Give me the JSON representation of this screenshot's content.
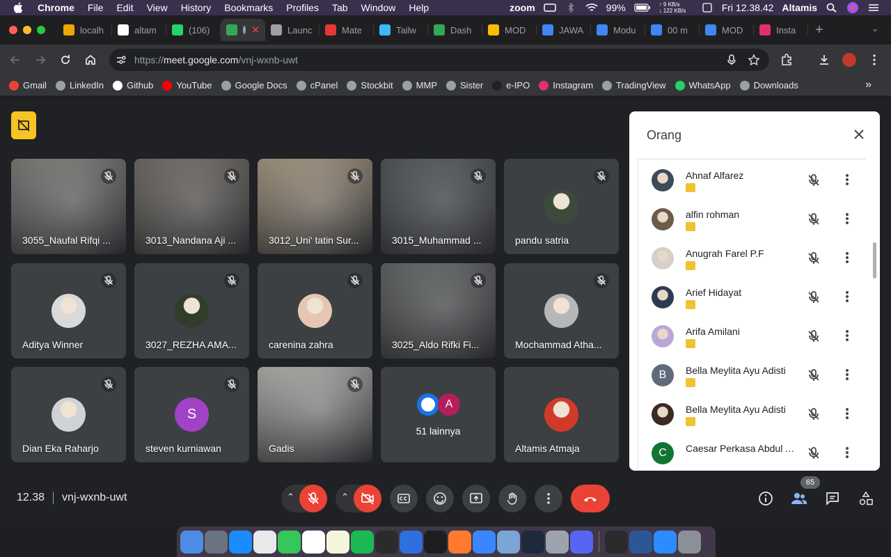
{
  "menubar": {
    "app_name": "Chrome",
    "menus": [
      "File",
      "Edit",
      "View",
      "History",
      "Bookmarks",
      "Profiles",
      "Tab",
      "Window",
      "Help"
    ],
    "zoom_label": "zoom",
    "net_up": "↑ 9 KB/s",
    "net_down": "↓ 122 KB/s",
    "battery": "99%",
    "clock": "Fri 12.38.42",
    "user": "Altamis"
  },
  "tabs": [
    {
      "label": "localh",
      "color": "#f0a500"
    },
    {
      "label": "altam",
      "color": "#ffffff"
    },
    {
      "label": "(106)",
      "color": "#25d366"
    },
    {
      "label": "",
      "color": "#34a853",
      "active": true
    },
    {
      "label": "Launc",
      "color": "#9aa0a6"
    },
    {
      "label": "Mate",
      "color": "#e53935"
    },
    {
      "label": "Tailw",
      "color": "#38bdf8"
    },
    {
      "label": "Dash",
      "color": "#34a853"
    },
    {
      "label": "MOD",
      "color": "#fbbc04"
    },
    {
      "label": "JAWA",
      "color": "#4285f4"
    },
    {
      "label": "Modu",
      "color": "#4285f4"
    },
    {
      "label": "00 m",
      "color": "#4285f4"
    },
    {
      "label": "MOD",
      "color": "#4285f4"
    },
    {
      "label": "Insta",
      "color": "#e1306c"
    }
  ],
  "omnibox": {
    "url_prefix": "https://",
    "url_host": "meet.google.com",
    "url_path": "/vnj-wxnb-uwt"
  },
  "bookmarks": [
    {
      "label": "Gmail",
      "color": "#ea4335"
    },
    {
      "label": "LinkedIn",
      "color": "#9aa0a6"
    },
    {
      "label": "Github",
      "color": "#ffffff"
    },
    {
      "label": "YouTube",
      "color": "#ff0000"
    },
    {
      "label": "Google Docs",
      "color": "#9aa0a6"
    },
    {
      "label": "cPanel",
      "color": "#9aa0a6"
    },
    {
      "label": "Stockbit",
      "color": "#9aa0a6"
    },
    {
      "label": "MMP",
      "color": "#9aa0a6"
    },
    {
      "label": "Sister",
      "color": "#9aa0a6"
    },
    {
      "label": "e-IPO",
      "color": "#202124"
    },
    {
      "label": "Instagram",
      "color": "#e1306c"
    },
    {
      "label": "TradingView",
      "color": "#9aa0a6"
    },
    {
      "label": "WhatsApp",
      "color": "#25d366"
    },
    {
      "label": "Downloads",
      "color": "#9aa0a6"
    }
  ],
  "tiles": [
    {
      "name": "3055_Naufal Rifqi ...",
      "kind": "video",
      "bg": "#8c8a86"
    },
    {
      "name": "3013_Nandana Aji ...",
      "kind": "video",
      "bg": "#7d7770"
    },
    {
      "name": "3012_Uni' tatin Sur...",
      "kind": "video",
      "bg": "#b9a88f"
    },
    {
      "name": "3015_Muhammad ...",
      "kind": "video",
      "bg": "#5b5f63"
    },
    {
      "name": "pandu satria",
      "kind": "avatar",
      "avatar_color": "#3b4a3a"
    },
    {
      "name": "Aditya Winner",
      "kind": "avatar",
      "avatar_color": "#d9d9d9"
    },
    {
      "name": "3027_REZHA AMA...",
      "kind": "avatar",
      "avatar_color": "#2f3d2a"
    },
    {
      "name": "carenina zahra",
      "kind": "avatar",
      "avatar_color": "#e6c6b2"
    },
    {
      "name": "3025_Aldo Rifki Fi...",
      "kind": "video",
      "bg": "#6b6e70"
    },
    {
      "name": "Mochammad Atha...",
      "kind": "avatar",
      "avatar_color": "#b7b7b7"
    },
    {
      "name": "Dian Eka Raharjo",
      "kind": "avatar",
      "avatar_color": "#cfd3d6"
    },
    {
      "name": "steven kurniawan",
      "kind": "letter",
      "letter": "S",
      "avatar_color": "#a142c7"
    },
    {
      "name": "Gadis",
      "kind": "video",
      "bg": "#c9c6c2"
    },
    {
      "name": "51 lainnya",
      "kind": "more",
      "letter": "A"
    },
    {
      "name": "Altamis Atmaja",
      "kind": "avatar",
      "avatar_color": "#d13a2b",
      "no_mic": true
    }
  ],
  "panel": {
    "title": "Orang",
    "people": [
      {
        "name": "Ahnaf Alfarez",
        "avatar_color": "#3d4a5a"
      },
      {
        "name": "alfin rohman",
        "avatar_color": "#6b5b4a"
      },
      {
        "name": "Anugrah Farel P.F",
        "avatar_color": "#d6d0c8"
      },
      {
        "name": "Arief Hidayat",
        "avatar_color": "#2d3a52"
      },
      {
        "name": "Arifa Amilani",
        "avatar_color": "#b9a7d6"
      },
      {
        "name": "Bella Meylita Ayu Adisti",
        "avatar_color": "#5f6b78",
        "letter": "B"
      },
      {
        "name": "Bella Meylita Ayu Adisti",
        "avatar_color": "#3b2a22"
      },
      {
        "name": "Caesar Perkasa Abdul A...",
        "avatar_color": "#137333",
        "letter": "C"
      }
    ]
  },
  "footer": {
    "time": "12.38",
    "meeting_code": "vnj-wxnb-uwt",
    "people_count": "65"
  },
  "dock": [
    "#4e8de6",
    "#6b7280",
    "#1a8cff",
    "#e9e9e9",
    "#34c759",
    "#ffffff",
    "#f5f5dc",
    "#1db954",
    "#2b2b2b",
    "#2f6fde",
    "#1e1e1e",
    "#ff7a2f",
    "#3a86ff",
    "#7aa5d6",
    "#1e293b",
    "#9ca3af",
    "#5865f2",
    "#2b2b2b",
    "#2b5797",
    "#2d8cff",
    "#8a8f98"
  ]
}
